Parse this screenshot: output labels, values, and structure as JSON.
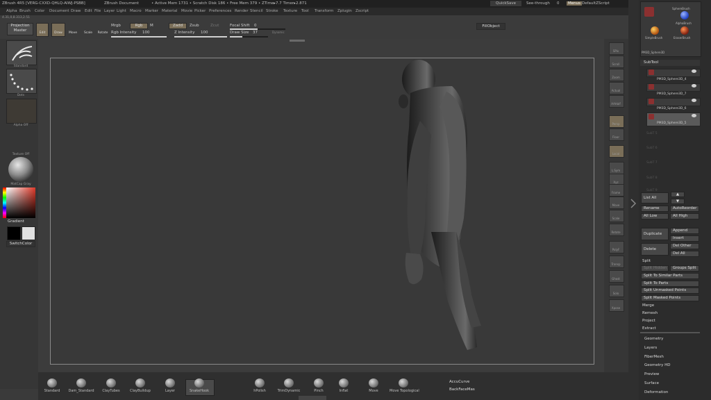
{
  "titlebar": {
    "app": "ZBrush 4R5 [VERG-CXXD-QHLQ-AIWJ-PSBB]",
    "doc": "ZBrush Document",
    "mem": "• Active Mem 1731 • Scratch Disk 186 • Free Mem 379 • ZTime▸7.7 Timer▸2.871",
    "quicksave": "QuickSave",
    "seethrough": "See-through",
    "seethrough_val": "0",
    "menus_btn": "Menus",
    "script": "DefaultZScript"
  },
  "menubar": [
    "Alpha",
    "Brush",
    "Color",
    "Document",
    "Draw",
    "Edit",
    "File",
    "Layer",
    "Light",
    "Macro",
    "Marker",
    "Material",
    "Movie",
    "Picker",
    "Preferences",
    "Render",
    "Stencil",
    "Stroke",
    "Texture",
    "Tool",
    "Transform",
    "Zplugin",
    "Zscript"
  ],
  "coords": "4.31,0,8.313,2.51",
  "toolbar": {
    "projection_master": "Projection Master",
    "edit": "Edit",
    "draw": "Draw",
    "move": "Move",
    "scale": "Scale",
    "rotate": "Rotate",
    "mrgb": "Mrgb",
    "rgb": "Rgb",
    "m": "M",
    "rgb_intensity": "Rgb Intensity",
    "rgb_intensity_val": "100",
    "zadd": "Zadd",
    "zsub": "Zsub",
    "zcut": "Zcut",
    "z_intensity": "Z Intensity",
    "z_intensity_val": "100",
    "focal_shift": "Focal Shift",
    "focal_shift_val": "0",
    "draw_size": "Draw Size",
    "draw_size_val": "37",
    "dynamic": "Dynamic",
    "fillobject": "FillObject"
  },
  "leftshelf": {
    "brush": "Standard",
    "stroke": "Dots",
    "alpha": "Alpha Off",
    "texture": "Texture Off",
    "material": "MatCap Gray",
    "gradient": "Gradient",
    "switchcolor": "SwitchColor"
  },
  "rightshelf": [
    "SPix",
    "Scroll",
    "Zoom",
    "Actual",
    "AAHalf",
    "Persp",
    "Floor",
    "Local",
    "L.Sym",
    "Xyz",
    "Frame",
    "Move",
    "Scale",
    "Rotate",
    "PolyF",
    "Transp",
    "Ghost",
    "Solo",
    "Xpose"
  ],
  "panel": {
    "brushes": [
      "SphereBrush",
      "AlphaBrush",
      "SimpleBrush",
      "EraserBrush",
      "PM3D_Sphere3D"
    ],
    "subtool_header": "SubTool",
    "subtools": [
      "PM3D_Sphere3D_4",
      "PM3D_Sphere3D_7",
      "PM3D_Sphere3D_6",
      "PM3D_Sphere3D_5"
    ],
    "empty_slots": [
      "SubT 5",
      "SubT 6",
      "SubT 7",
      "SubT 8",
      "SubT 9"
    ],
    "list_all": "List All",
    "rename": "Rename",
    "autoreorder": "AutoReorder",
    "all_low": "All Low",
    "all_high": "All High",
    "duplicate": "Duplicate",
    "append": "Append",
    "insert": "Insert",
    "delete": "Delete",
    "del_other": "Del Other",
    "del_all": "Del All",
    "split": "Split",
    "split_hidden": "Split Hidden",
    "groups_split": "Groups Split",
    "split_similar": "Split To Similar Parts",
    "split_parts": "Split To Parts",
    "split_unmasked": "Split Unmasked Points",
    "split_masked": "Split Masked Points",
    "merge": "Merge",
    "remesh": "Remesh",
    "project": "Project",
    "extract": "Extract",
    "sections": [
      "Geometry",
      "Layers",
      "FiberMesh",
      "Geometry HD",
      "Preview",
      "Surface",
      "Deformation"
    ]
  },
  "bottom": {
    "brushes": [
      "Standard",
      "Dam_Standard",
      "ClayTubes",
      "ClayBuildup",
      "Layer",
      "SnakeHook",
      "hPolish",
      "TrimDynamic",
      "Pinch",
      "Inflat",
      "Move",
      "Move Topological"
    ],
    "accucurve": "AccuCurve",
    "backfacemask": "BackFaceMas"
  },
  "colors": {
    "accent_active": "#7a6e58",
    "canvas": "#393939",
    "main_color": "#000000",
    "secondary_color": "#e0e0e0"
  }
}
